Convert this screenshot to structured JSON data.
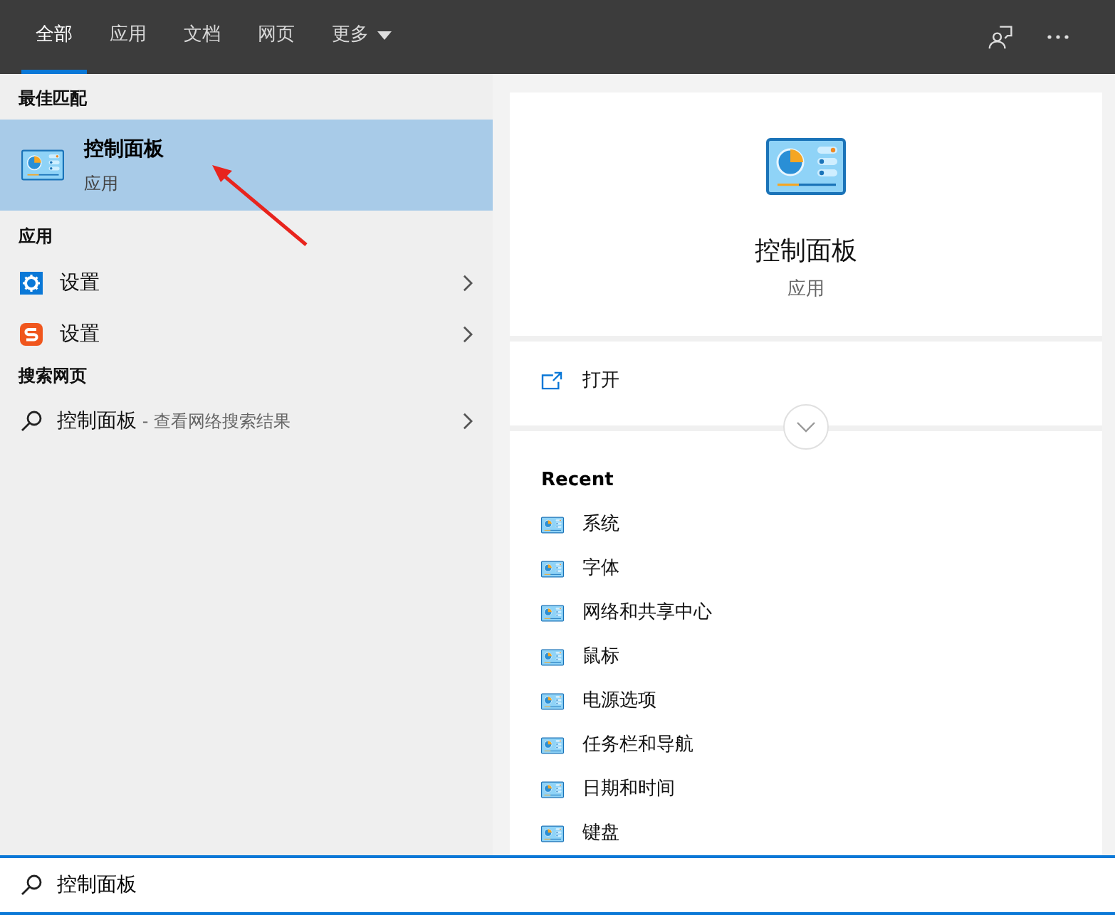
{
  "tabs": [
    {
      "label": "全部",
      "selected": true,
      "kind": "plain"
    },
    {
      "label": "应用",
      "selected": false,
      "kind": "plain"
    },
    {
      "label": "文档",
      "selected": false,
      "kind": "plain"
    },
    {
      "label": "网页",
      "selected": false,
      "kind": "plain"
    },
    {
      "label": "更多",
      "selected": false,
      "kind": "menu"
    }
  ],
  "best_match": {
    "heading": "最佳匹配",
    "item": {
      "title": "控制面板",
      "subtitle": "应用",
      "selected": true
    }
  },
  "apps": {
    "heading": "应用",
    "items": [
      {
        "label": "设置",
        "kind": "gear"
      },
      {
        "label": "设置",
        "kind": "sogou"
      }
    ]
  },
  "web": {
    "heading": "搜索网页",
    "item": {
      "query": "控制面板",
      "hint": " - 查看网络搜索结果"
    }
  },
  "detail": {
    "title": "控制面板",
    "subtitle": "应用",
    "actions": [
      {
        "label": "打开"
      }
    ],
    "recent_heading": "Recent",
    "recent": [
      "系统",
      "字体",
      "网络和共享中心",
      "鼠标",
      "电源选项",
      "任务栏和导航",
      "日期和时间",
      "键盘"
    ]
  },
  "search": {
    "value": "控制面板"
  }
}
